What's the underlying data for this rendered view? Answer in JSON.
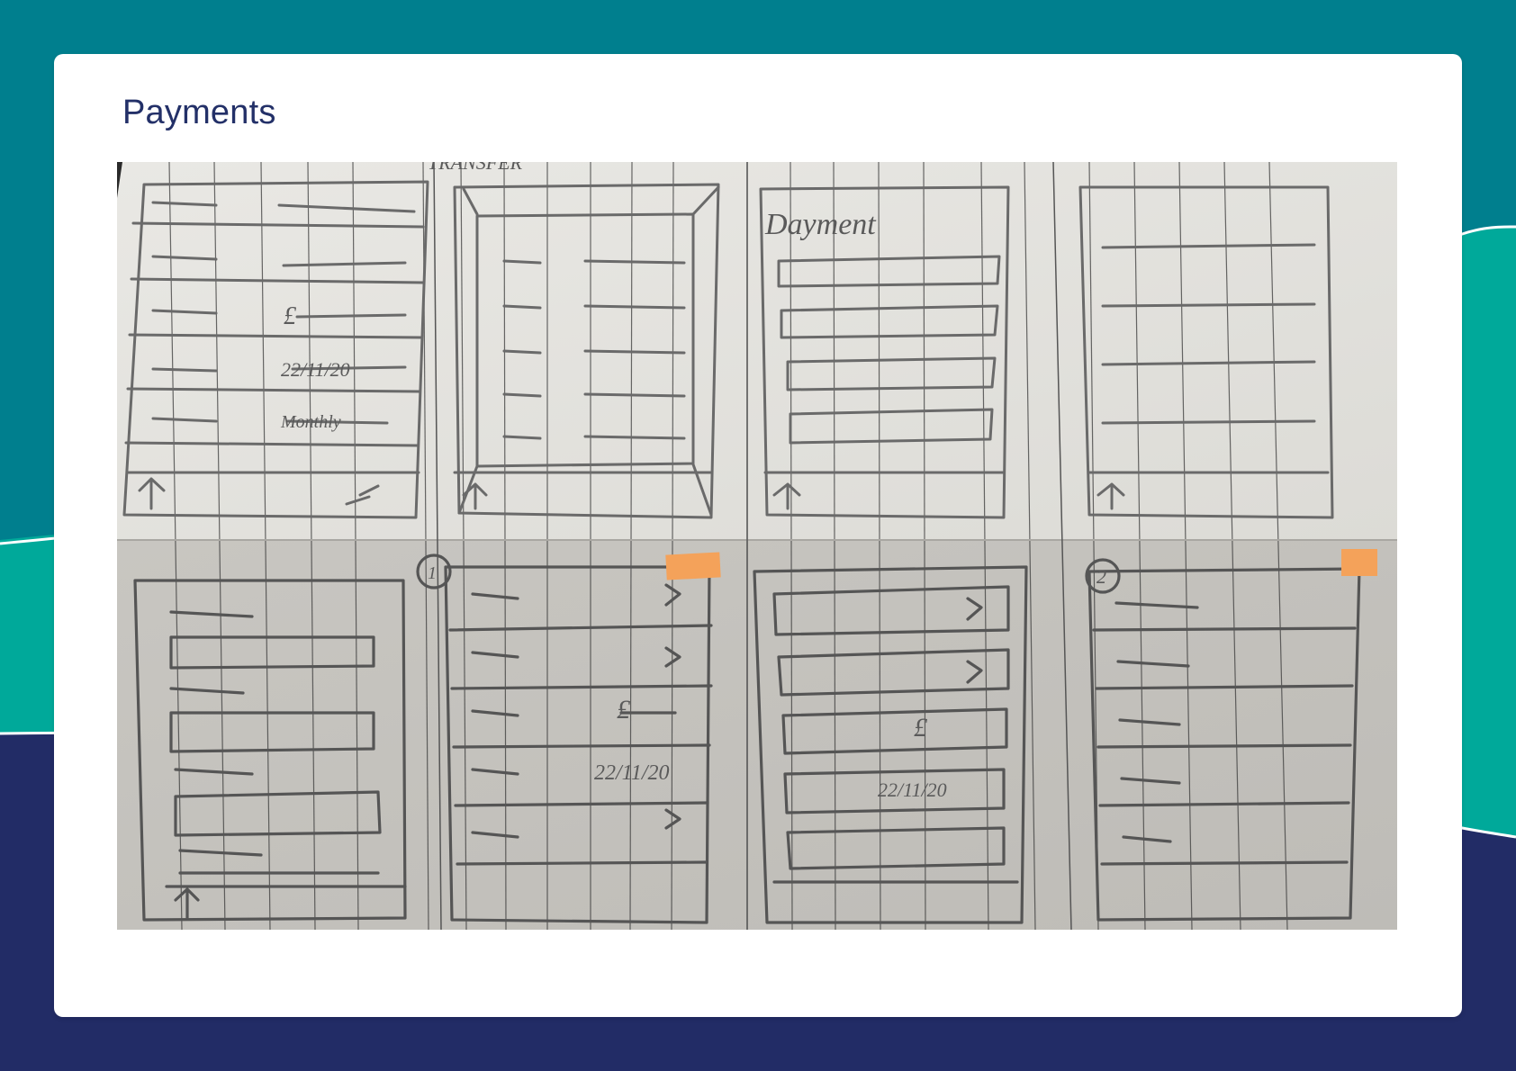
{
  "page": {
    "title": "Payments"
  },
  "sketch_photo": {
    "description_icon": "hand-drawn-wireframe-photo",
    "labels": {
      "header_scrawl": "TRANSFER",
      "panel_title": "Dayment",
      "date": "22/11/20",
      "currency": "£",
      "monthly": "Monthly",
      "step_one": "1",
      "step_two": "2"
    }
  },
  "colors": {
    "teal_dark": "#007f8e",
    "teal_light": "#00a99a",
    "navy": "#222c66",
    "title": "#233068",
    "sticky_note": "#f4a25a"
  }
}
